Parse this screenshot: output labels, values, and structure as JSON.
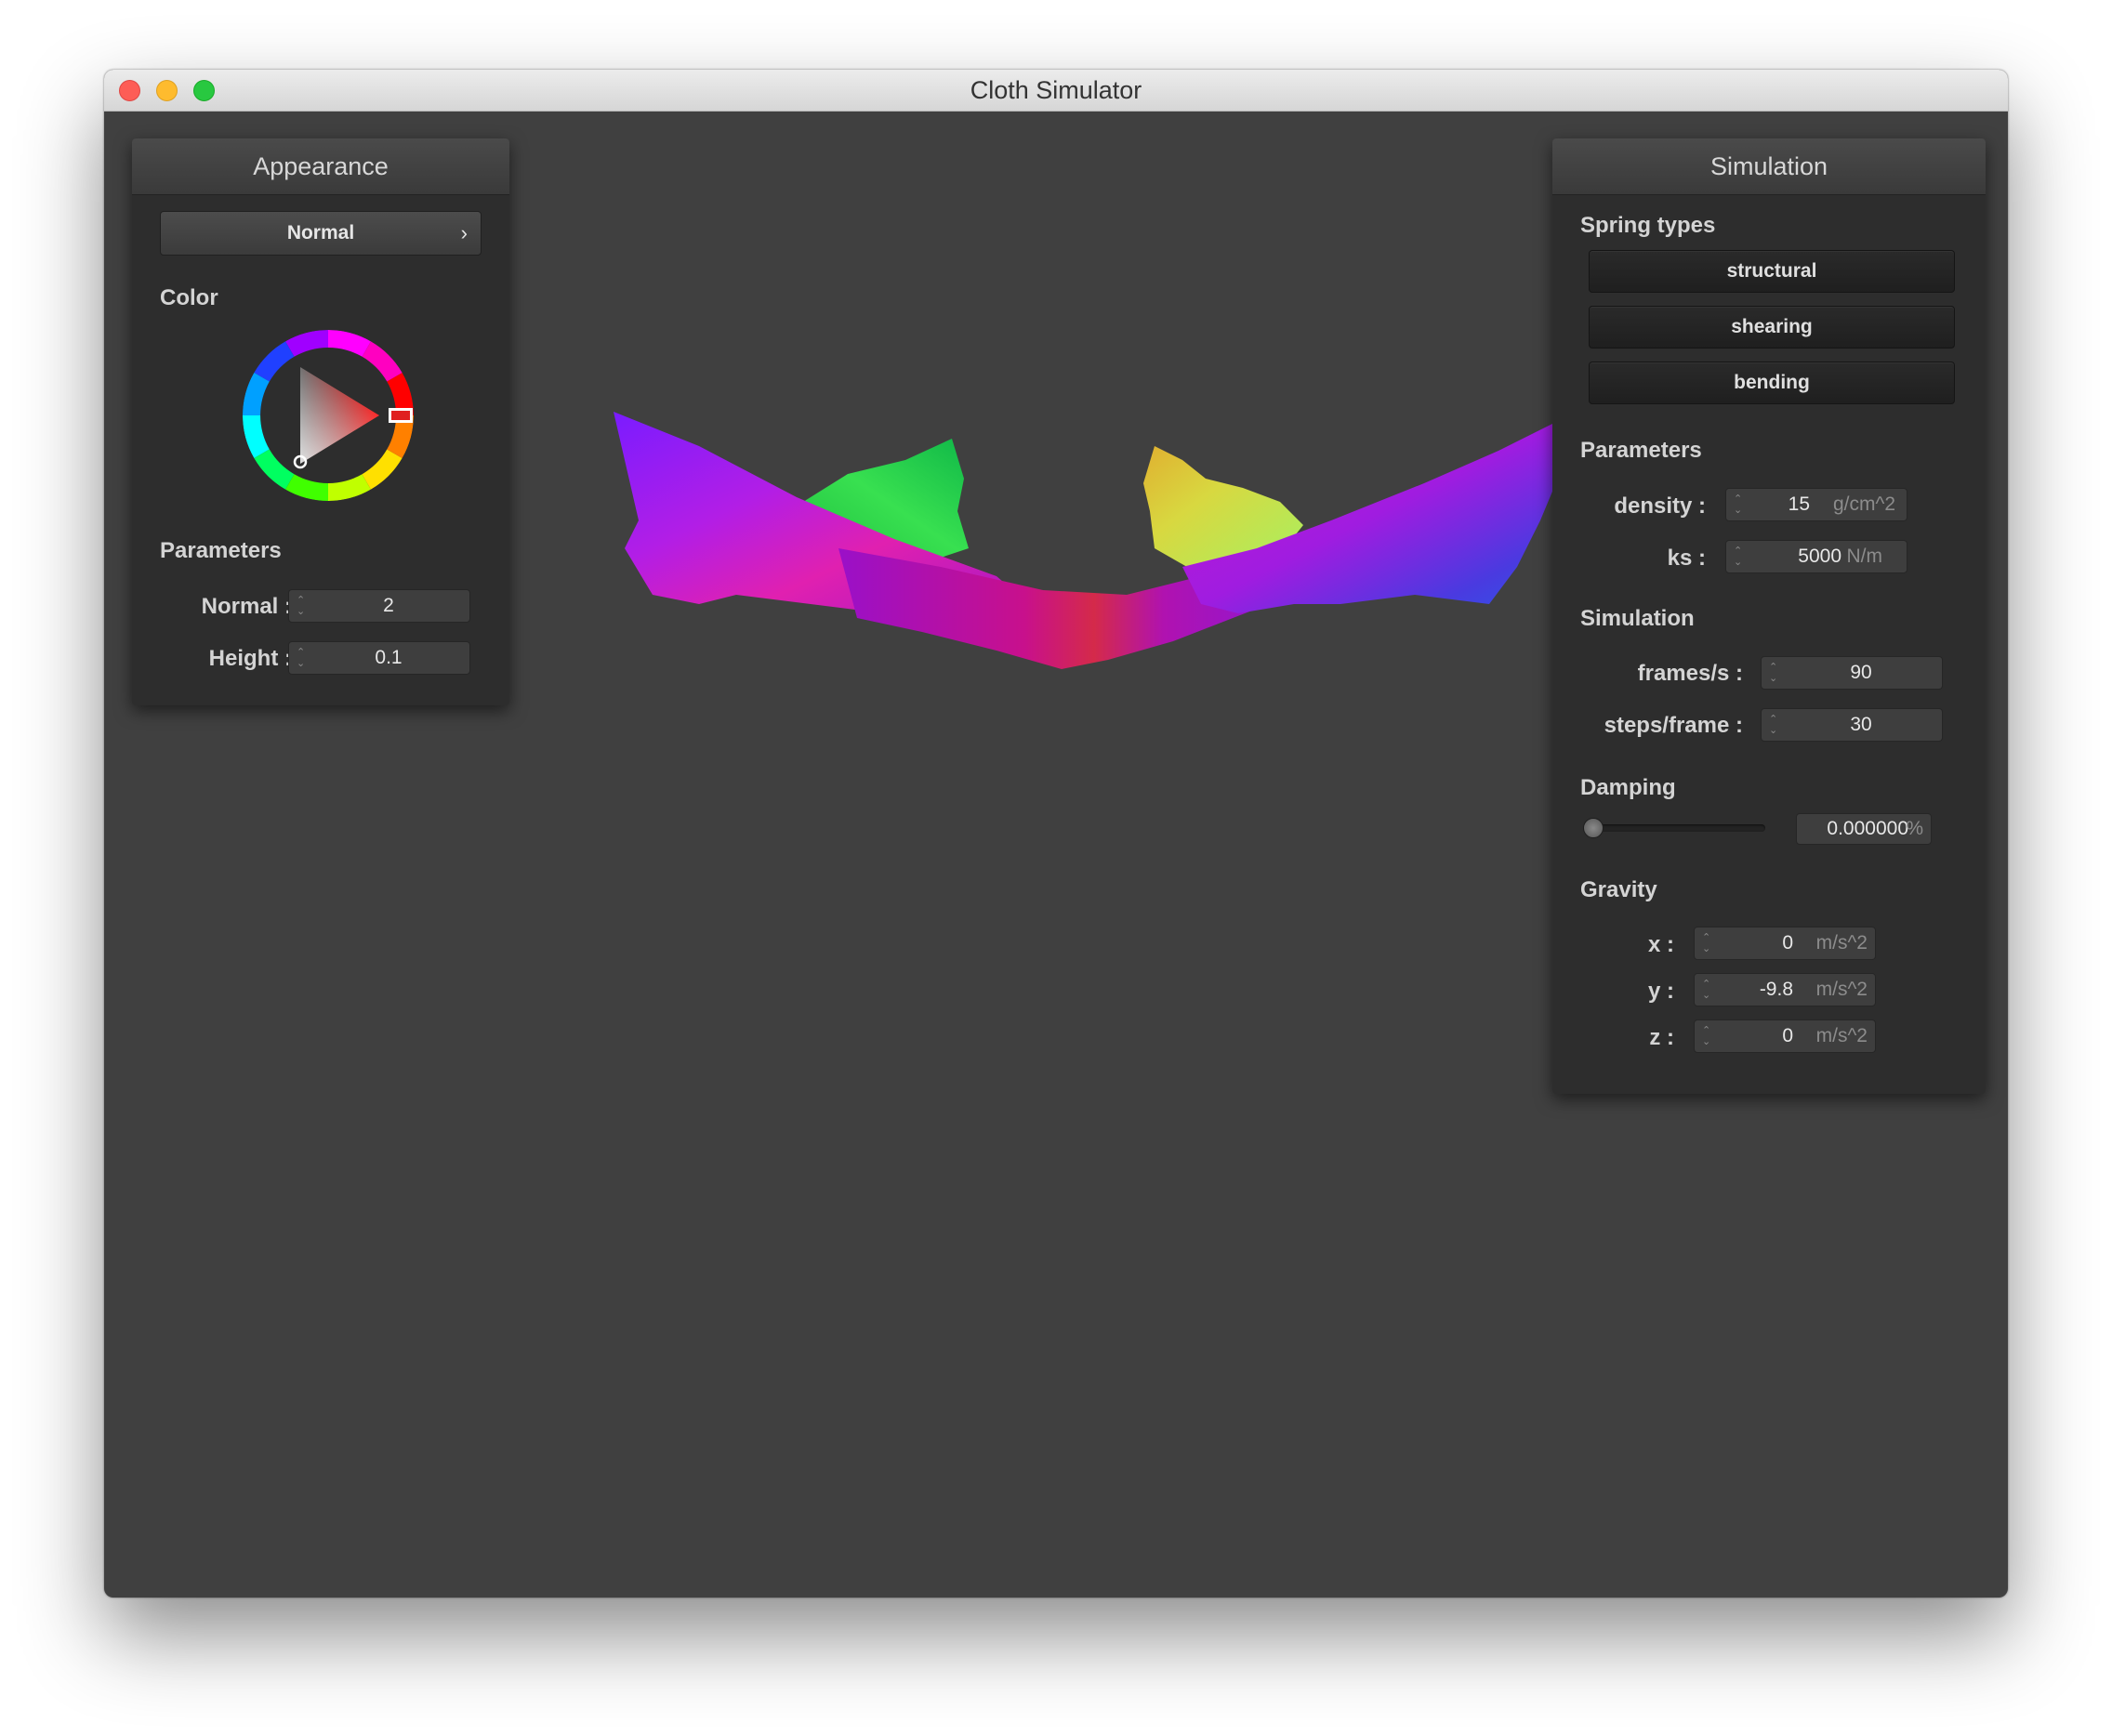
{
  "window": {
    "title": "Cloth Simulator"
  },
  "appearance": {
    "header": "Appearance",
    "shader_dropdown": {
      "selected": "Normal",
      "chevron": "›"
    },
    "color_label": "Color",
    "color_wheel": {
      "hue_color": "#ff0000"
    },
    "parameters_label": "Parameters",
    "normal": {
      "label": "Normal :",
      "value": "2"
    },
    "height": {
      "label": "Height :",
      "value": "0.1"
    }
  },
  "simulation": {
    "header": "Simulation",
    "spring_types_label": "Spring types",
    "springs": [
      {
        "label": "structural"
      },
      {
        "label": "shearing"
      },
      {
        "label": "bending"
      }
    ],
    "parameters_label": "Parameters",
    "density": {
      "label": "density :",
      "value": "15",
      "unit": "g/cm^2"
    },
    "ks": {
      "label": "ks :",
      "value": "5000",
      "unit": "N/m"
    },
    "simulation_label": "Simulation",
    "fps": {
      "label": "frames/s :",
      "value": "90"
    },
    "steps": {
      "label": "steps/frame :",
      "value": "30"
    },
    "damping_label": "Damping",
    "damping": {
      "value": "0.000000",
      "unit": "%",
      "fraction": 0
    },
    "gravity_label": "Gravity",
    "gravity": [
      {
        "label": "x :",
        "value": "0",
        "unit": "m/s^2"
      },
      {
        "label": "y :",
        "value": "-9.8",
        "unit": "m/s^2"
      },
      {
        "label": "z :",
        "value": "0",
        "unit": "m/s^2"
      }
    ]
  },
  "icons": {
    "close": "close-icon",
    "minimize": "minimize-icon",
    "maximize": "maximize-icon",
    "spinner": "spinner-arrows-icon",
    "chevron": "chevron-right-icon"
  },
  "colors": {
    "canvas_bg": "#404040",
    "panel_bg": "#2d2d2d",
    "close": "#fd5d56",
    "minimize": "#febb2e",
    "maximize": "#28c840"
  }
}
